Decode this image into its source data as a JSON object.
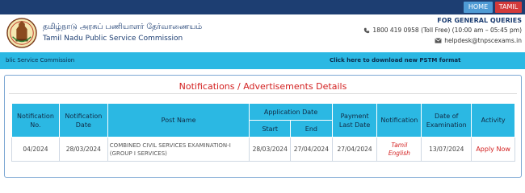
{
  "topbar": {
    "home_label": "HOME",
    "tamil_label": "TAMIL"
  },
  "header": {
    "org_name_tamil": "தமிழ்நாடு அரசுப் பணியாளர் தேர்வாணையம்",
    "org_name_english": "Tamil Nadu Public Service Commission",
    "queries_title": "FOR GENERAL QUERIES",
    "phone": "1800 419 0958 (Toll Free)  (10:00 am – 05:45 pm)",
    "email": "helpdesk@tnpscexams.in"
  },
  "strip": {
    "marquee_text": "blic Service Commission",
    "pstm_link": "Click here to download new PSTM format"
  },
  "panel": {
    "title": "Notifications / Advertisements Details",
    "headers": {
      "notification_no": "Notification No.",
      "notification_date": "Notification Date",
      "post_name": "Post Name",
      "application_date": "Application Date",
      "start": "Start",
      "end": "End",
      "payment_last_date": "Payment Last Date",
      "notification": "Notification",
      "exam_date": "Date of Examination",
      "activity": "Activity"
    },
    "rows": [
      {
        "notification_no": "04/2024",
        "notification_date": "28/03/2024",
        "post_name": "COMBINED CIVIL SERVICES EXAMINATION-I (GROUP I SERVICES)",
        "start": "28/03/2024",
        "end": "27/04/2024",
        "payment_last_date": "27/04/2024",
        "notification_tamil": "Tamil",
        "notification_english": "English",
        "exam_date": "13/07/2024",
        "activity": "Apply Now"
      }
    ]
  },
  "colors": {
    "navy": "#1d3e72",
    "cyan": "#2bb8e3",
    "red": "#d32020"
  }
}
